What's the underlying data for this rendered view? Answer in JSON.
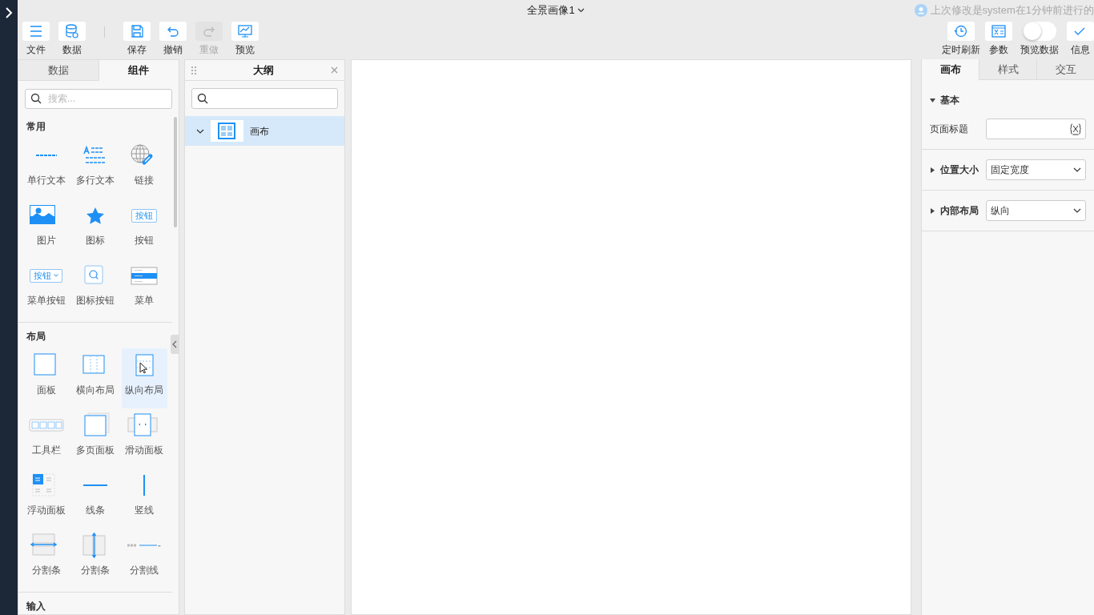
{
  "window": {
    "title": "全景画像1",
    "notice": "上次修改是system在1分钟前进行的"
  },
  "toolbar_left": [
    {
      "label": "文件",
      "kind": "menu",
      "disabled": false
    },
    {
      "label": "数据",
      "kind": "database",
      "disabled": false
    },
    {
      "label": "保存",
      "kind": "save",
      "disabled": false
    },
    {
      "label": "撤销",
      "kind": "undo",
      "disabled": false
    },
    {
      "label": "重做",
      "kind": "redo",
      "disabled": true
    },
    {
      "label": "预览",
      "kind": "preview",
      "disabled": false
    }
  ],
  "toolbar_right": [
    {
      "label": "定时刷新",
      "kind": "timer"
    },
    {
      "label": "参数",
      "kind": "params"
    },
    {
      "label": "预览数据",
      "kind": "toggle",
      "on": false
    },
    {
      "label": "信息",
      "kind": "check"
    }
  ],
  "left_panel": {
    "tabs": [
      {
        "label": "数据",
        "selected": false
      },
      {
        "label": "组件",
        "selected": true
      }
    ],
    "search": {
      "placeholder": "搜索..."
    },
    "sections": [
      {
        "title": "常用",
        "items": [
          {
            "label": "单行文本",
            "kind": "single-text",
            "selected": false
          },
          {
            "label": "多行文本",
            "kind": "multi-text",
            "selected": false
          },
          {
            "label": "链接",
            "kind": "link",
            "selected": false
          },
          {
            "label": "图片",
            "kind": "image",
            "selected": false
          },
          {
            "label": "图标",
            "kind": "star",
            "selected": false
          },
          {
            "label": "按钮",
            "kind": "button",
            "icon_texts": [
              "按钮"
            ],
            "selected": false
          },
          {
            "label": "菜单按钮",
            "kind": "menu-button",
            "icon_texts": [
              "按钮"
            ],
            "selected": false
          },
          {
            "label": "图标按钮",
            "kind": "icon-button",
            "selected": false
          },
          {
            "label": "菜单",
            "kind": "menu",
            "selected": false
          }
        ]
      },
      {
        "title": "布局",
        "items": [
          {
            "label": "面板",
            "kind": "panel",
            "selected": false
          },
          {
            "label": "横向布局",
            "kind": "h-layout",
            "selected": false
          },
          {
            "label": "纵向布局",
            "kind": "v-layout",
            "selected": true
          },
          {
            "label": "工具栏",
            "kind": "toolbar",
            "selected": false
          },
          {
            "label": "多页面板",
            "kind": "multipage",
            "selected": false
          },
          {
            "label": "滑动面板",
            "kind": "slide",
            "selected": false
          },
          {
            "label": "浮动面板",
            "kind": "float",
            "selected": false
          },
          {
            "label": "线条",
            "kind": "line",
            "selected": false
          },
          {
            "label": "竖线",
            "kind": "vline",
            "selected": false
          },
          {
            "label": "分割条",
            "kind": "h-split",
            "selected": false
          },
          {
            "label": "分割条",
            "kind": "v-split",
            "selected": false
          },
          {
            "label": "分割线",
            "kind": "divider",
            "selected": false
          }
        ]
      },
      {
        "title": "输入"
      }
    ]
  },
  "outline": {
    "title": "大纲",
    "tree": [
      {
        "label": "画布",
        "expanded": true,
        "selected": true
      }
    ]
  },
  "right_panel": {
    "tabs": [
      {
        "label": "画布",
        "selected": true
      },
      {
        "label": "样式",
        "selected": false
      },
      {
        "label": "交互",
        "selected": false
      }
    ],
    "groups": [
      {
        "title": "基本",
        "expanded": true,
        "fields": [
          {
            "label": "页面标题",
            "kind": "text"
          }
        ]
      },
      {
        "title": "位置大小",
        "expanded": false,
        "fields": [
          {
            "kind": "select",
            "value": "固定宽度"
          }
        ]
      },
      {
        "title": "内部布局",
        "expanded": false,
        "fields": [
          {
            "kind": "select",
            "value": "纵向"
          }
        ]
      }
    ]
  }
}
